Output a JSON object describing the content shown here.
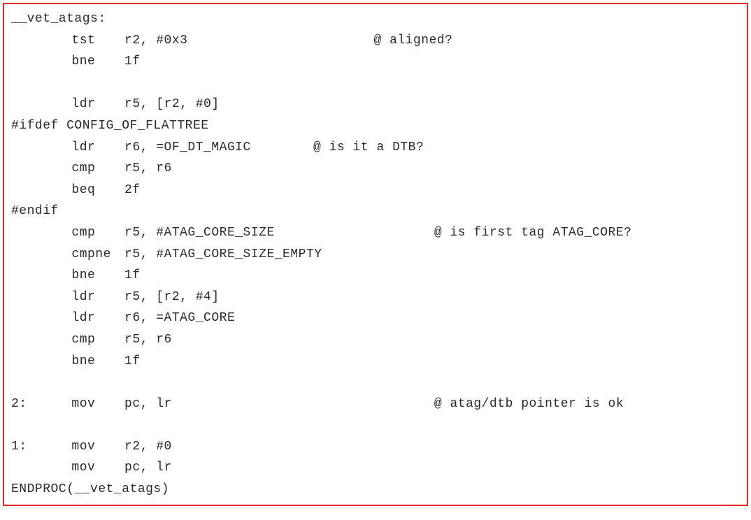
{
  "code": {
    "lines": [
      {
        "label": "__vet_atags:",
        "op": "",
        "args": "",
        "comment": ""
      },
      {
        "label": "",
        "op": "tst",
        "args": "r2, #0x3",
        "comment": "@ aligned?"
      },
      {
        "label": "",
        "op": "bne",
        "args": "1f",
        "comment": ""
      },
      {
        "label": "",
        "op": "",
        "args": "",
        "comment": ""
      },
      {
        "label": "",
        "op": "ldr",
        "args": "r5, [r2, #0]",
        "comment": ""
      },
      {
        "label": "#ifdef CONFIG_OF_FLATTREE",
        "op": "",
        "args": "",
        "comment": ""
      },
      {
        "label": "",
        "op": "ldr",
        "args": "r6, =OF_DT_MAGIC",
        "comment": "@ is it a DTB?",
        "argwidth": "narrow"
      },
      {
        "label": "",
        "op": "cmp",
        "args": "r5, r6",
        "comment": ""
      },
      {
        "label": "",
        "op": "beq",
        "args": "2f",
        "comment": ""
      },
      {
        "label": "#endif",
        "op": "",
        "args": "",
        "comment": ""
      },
      {
        "label": "",
        "op": "cmp",
        "args": "r5, #ATAG_CORE_SIZE",
        "comment": "@ is first tag ATAG_CORE?",
        "argwidth": "wide"
      },
      {
        "label": "",
        "op": "cmpne",
        "args": "r5, #ATAG_CORE_SIZE_EMPTY",
        "comment": ""
      },
      {
        "label": "",
        "op": "bne",
        "args": "1f",
        "comment": ""
      },
      {
        "label": "",
        "op": "ldr",
        "args": "r5, [r2, #4]",
        "comment": ""
      },
      {
        "label": "",
        "op": "ldr",
        "args": "r6, =ATAG_CORE",
        "comment": ""
      },
      {
        "label": "",
        "op": "cmp",
        "args": "r5, r6",
        "comment": ""
      },
      {
        "label": "",
        "op": "bne",
        "args": "1f",
        "comment": ""
      },
      {
        "label": "",
        "op": "",
        "args": "",
        "comment": ""
      },
      {
        "label": "2:",
        "op": "mov",
        "args": "pc, lr",
        "comment": "@ atag/dtb pointer is ok",
        "argwidth": "wide"
      },
      {
        "label": "",
        "op": "",
        "args": "",
        "comment": ""
      },
      {
        "label": "1:",
        "op": "mov",
        "args": "r2, #0",
        "comment": ""
      },
      {
        "label": "",
        "op": "mov",
        "args": "pc, lr",
        "comment": ""
      },
      {
        "label": "ENDPROC(__vet_atags)",
        "op": "",
        "args": "",
        "comment": ""
      }
    ]
  }
}
